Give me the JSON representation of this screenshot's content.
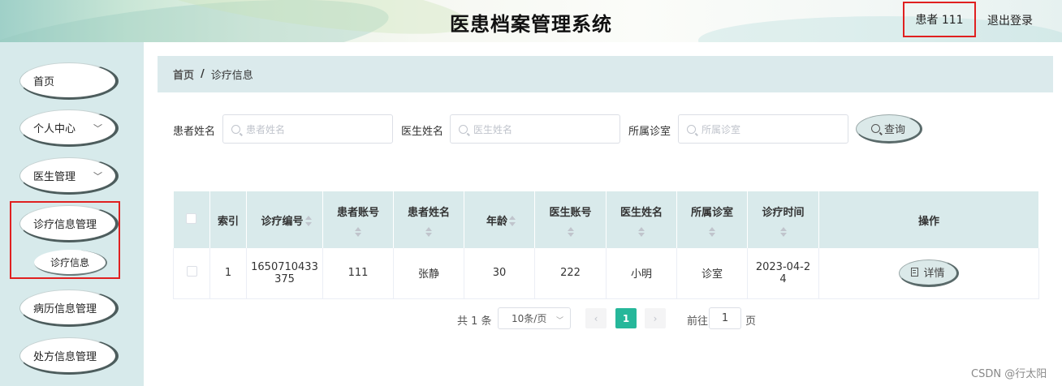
{
  "header": {
    "title": "医患档案管理系统",
    "user_label": "患者 111",
    "logout_label": "退出登录"
  },
  "sidebar": {
    "items": [
      {
        "label": "首页",
        "has_submenu": false
      },
      {
        "label": "个人中心",
        "has_submenu": true
      },
      {
        "label": "医生管理",
        "has_submenu": true
      },
      {
        "label": "诊疗信息管理",
        "has_submenu": true
      },
      {
        "label": "病历信息管理",
        "has_submenu": true
      },
      {
        "label": "处方信息管理",
        "has_submenu": true
      }
    ],
    "sub_item": "诊疗信息",
    "chevron": "chevron-down-icon"
  },
  "breadcrumb": {
    "home": "首页",
    "separator": "/",
    "current": "诊疗信息"
  },
  "search": {
    "patient_name_label": "患者姓名",
    "patient_name_placeholder": "患者姓名",
    "doctor_name_label": "医生姓名",
    "doctor_name_placeholder": "医生姓名",
    "clinic_label": "所属诊室",
    "clinic_placeholder": "所属诊室",
    "query_button": "查询"
  },
  "table": {
    "headers": {
      "index": "索引",
      "record_no": "诊疗编号",
      "patient_account": "患者账号",
      "patient_name": "患者姓名",
      "age": "年龄",
      "doctor_account": "医生账号",
      "doctor_name": "医生姓名",
      "clinic": "所属诊室",
      "visit_time": "诊疗时间",
      "actions": "操作"
    },
    "rows": [
      {
        "index": "1",
        "record_no_line1": "1650710433",
        "record_no_line2": "375",
        "patient_account": "111",
        "patient_name": "张静",
        "age": "30",
        "doctor_account": "222",
        "doctor_name": "小明",
        "clinic": "诊室",
        "visit_time_line1": "2023-04-2",
        "visit_time_line2": "4",
        "detail_button": "详情"
      }
    ]
  },
  "pagination": {
    "total": "共 1 条",
    "page_size": "10条/页",
    "prev": "‹",
    "current_page": "1",
    "next": "›",
    "goto_label": "前往",
    "goto_value": "1",
    "page_suffix": "页"
  },
  "watermark": "CSDN @行太阳",
  "colors": {
    "sidebar_bg": "#d7eaeb",
    "table_header_bg": "#d9eaeb",
    "active_page": "#26b79a",
    "highlight_box": "#e02020"
  }
}
